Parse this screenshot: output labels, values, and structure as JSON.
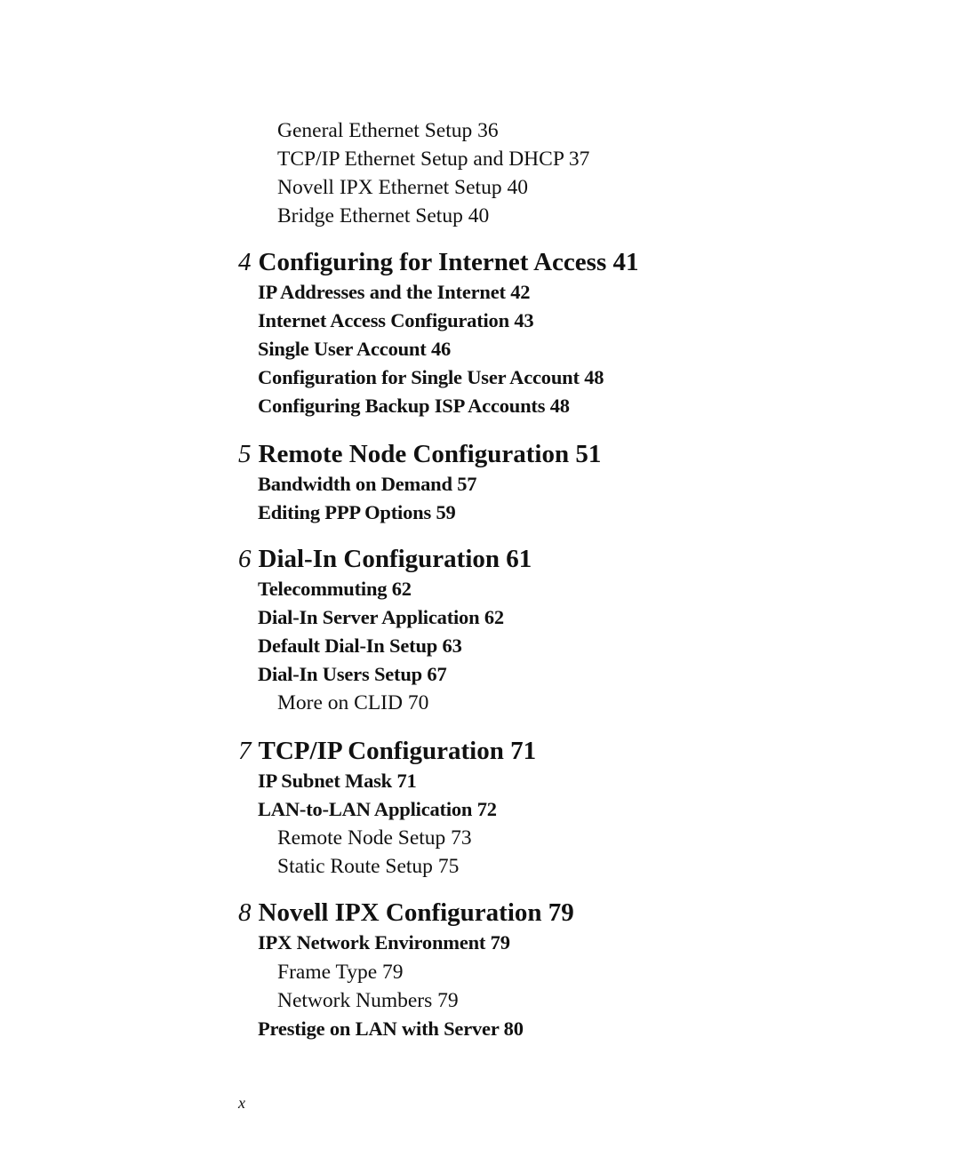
{
  "entries": [
    {
      "level": 3,
      "title": "General Ethernet Setup",
      "page": "36"
    },
    {
      "level": 3,
      "title": "TCP/IP Ethernet Setup and DHCP",
      "page": "37"
    },
    {
      "level": 3,
      "title": "Novell IPX Ethernet Setup",
      "page": "40"
    },
    {
      "level": 3,
      "title": "Bridge Ethernet Setup",
      "page": "40"
    },
    {
      "level": 1,
      "chapter": "4",
      "title": "Configuring for Internet Access",
      "page": "41"
    },
    {
      "level": 2,
      "title": "IP Addresses and the Internet",
      "page": "42"
    },
    {
      "level": 2,
      "title": "Internet Access Configuration",
      "page": "43"
    },
    {
      "level": 2,
      "title": "Single User Account",
      "page": "46"
    },
    {
      "level": 2,
      "title": "Configuration for Single User Account",
      "page": "48"
    },
    {
      "level": 2,
      "title": "Configuring Backup ISP Accounts",
      "page": "48"
    },
    {
      "level": 1,
      "chapter": "5",
      "title": "Remote Node Configuration",
      "page": "51"
    },
    {
      "level": 2,
      "title": "Bandwidth on Demand",
      "page": "57"
    },
    {
      "level": 2,
      "title": "Editing PPP Options",
      "page": "59"
    },
    {
      "level": 1,
      "chapter": "6",
      "title": "Dial-In Configuration",
      "page": "61"
    },
    {
      "level": 2,
      "title": "Telecommuting",
      "page": "62"
    },
    {
      "level": 2,
      "title": "Dial-In Server Application",
      "page": "62"
    },
    {
      "level": 2,
      "title": "Default Dial-In Setup",
      "page": "63"
    },
    {
      "level": 2,
      "title": "Dial-In Users Setup",
      "page": "67"
    },
    {
      "level": 3,
      "title": "More on CLID",
      "page": "70"
    },
    {
      "level": 1,
      "chapter": "7",
      "title": "TCP/IP Configuration",
      "page": "71"
    },
    {
      "level": 2,
      "title": "IP Subnet Mask",
      "page": "71"
    },
    {
      "level": 2,
      "title": "LAN-to-LAN Application",
      "page": "72"
    },
    {
      "level": 3,
      "title": "Remote Node Setup",
      "page": "73"
    },
    {
      "level": 3,
      "title": "Static Route Setup",
      "page": "75"
    },
    {
      "level": 1,
      "chapter": "8",
      "title": "Novell IPX Configuration",
      "page": "79"
    },
    {
      "level": 2,
      "title": "IPX Network Environment",
      "page": "79"
    },
    {
      "level": 3,
      "title": "Frame Type",
      "page": "79"
    },
    {
      "level": 3,
      "title": "Network Numbers",
      "page": "79"
    },
    {
      "level": 2,
      "title": "Prestige on LAN with Server",
      "page": "80"
    }
  ],
  "folio": "x"
}
